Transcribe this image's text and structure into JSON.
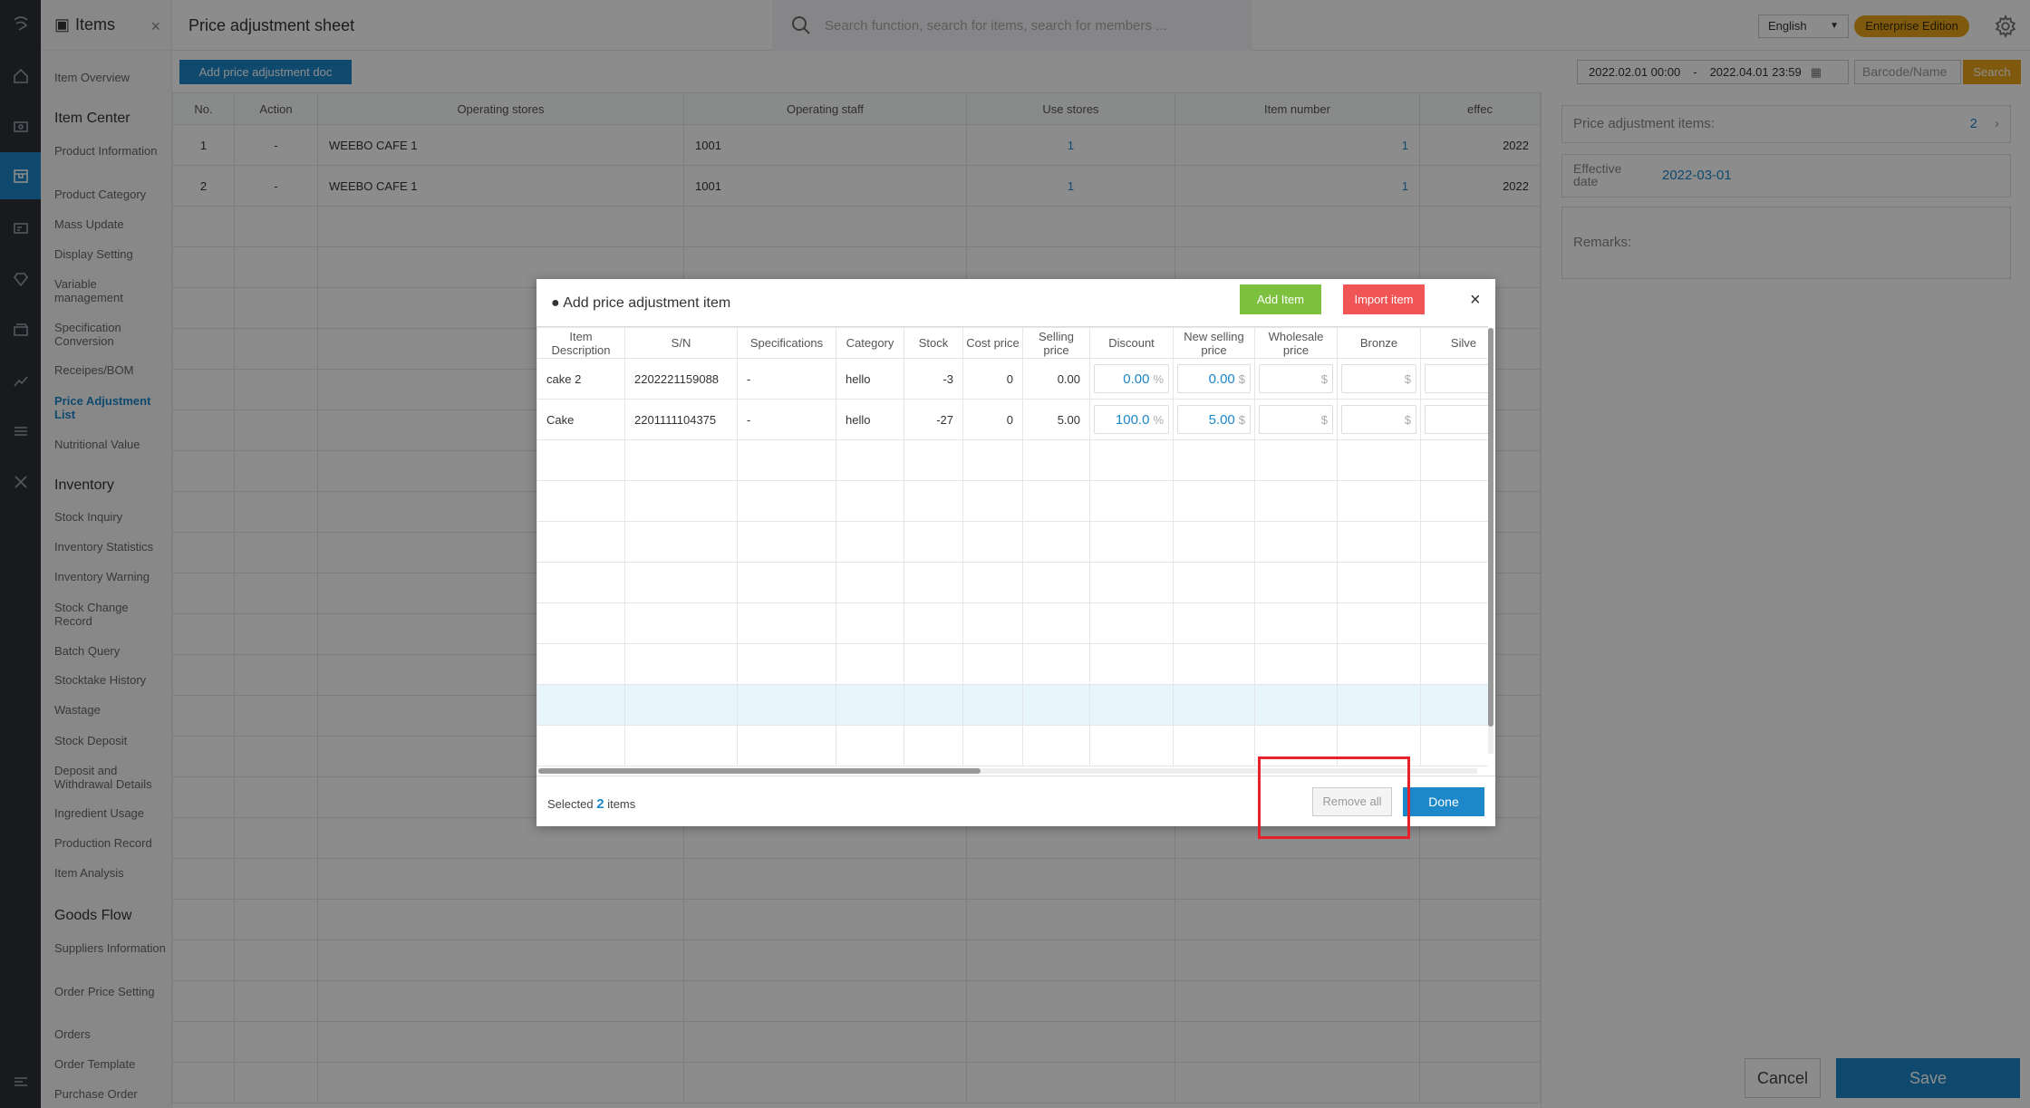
{
  "app": {
    "module_title": "Items",
    "page_title": "Price adjustment sheet"
  },
  "search": {
    "placeholder": "Search function, search for items, search for members ..."
  },
  "header": {
    "language": "English",
    "edition": "Enterprise Edition"
  },
  "sidebar": {
    "overview": "Item Overview",
    "sec_item_center": "Item Center",
    "item_center": [
      "Product Information",
      "Product Category",
      "Mass Update",
      "Display Setting",
      "Variable management",
      "Specification Conversion",
      "Receipes/BOM",
      "Price Adjustment List",
      "Nutritional Value"
    ],
    "sec_inventory": "Inventory",
    "inventory": [
      "Stock Inquiry",
      "Inventory Statistics",
      "Inventory Warning",
      "Stock Change Record",
      "Batch Query",
      "Stocktake History",
      "Wastage",
      "Stock Deposit",
      "Deposit and Withdrawal Details",
      "Ingredient Usage",
      "Production Record",
      "Item Analysis"
    ],
    "sec_goods_flow": "Goods Flow",
    "goods_flow": [
      "Suppliers Information",
      "Order Price Setting",
      "Orders",
      "Order Template",
      "Purchase Order"
    ]
  },
  "toolbar": {
    "add_doc": "Add price adjustment doc",
    "date_from": "2022.02.01 00:00",
    "date_sep": "-",
    "date_to": "2022.04.01 23:59",
    "barcode_placeholder": "Barcode/Name",
    "search": "Search"
  },
  "list": {
    "headers": [
      "No.",
      "Action",
      "Operating stores",
      "Operating staff",
      "Use stores",
      "Item number",
      "effec"
    ],
    "rows": [
      {
        "no": "1",
        "action": "-",
        "store": "WEEBO CAFE 1",
        "staff": "1001",
        "use": "1",
        "items": "1",
        "eff": "2022"
      },
      {
        "no": "2",
        "action": "-",
        "store": "WEEBO CAFE 1",
        "staff": "1001",
        "use": "1",
        "items": "1",
        "eff": "2022"
      }
    ]
  },
  "right_panel": {
    "items_label": "Price adjustment items:",
    "items_value": "2",
    "date_label": "Effective date",
    "date_value": "2022-03-01",
    "remarks_label": "Remarks:",
    "cancel": "Cancel",
    "save": "Save"
  },
  "modal": {
    "title": "● Add price adjustment item",
    "add_item": "Add Item",
    "import_item": "Import item",
    "close": "×",
    "headers": [
      "Item Description",
      "S/N",
      "Specifications",
      "Category",
      "Stock",
      "Cost price",
      "Selling price",
      "Discount",
      "New selling price",
      "Wholesale price",
      "Bronze",
      "Silve"
    ],
    "rows": [
      {
        "desc": "cake 2",
        "sn": "2202221159088",
        "spec": "-",
        "cat": "hello",
        "stock": "-3",
        "cost": "0",
        "sell": "0.00",
        "disc": "0.00",
        "new": "0.00"
      },
      {
        "desc": "Cake",
        "sn": "2201111104375",
        "spec": "-",
        "cat": "hello",
        "stock": "-27",
        "cost": "0",
        "sell": "5.00",
        "disc": "100.0",
        "new": "5.00"
      }
    ],
    "pct": "%",
    "cur": "$",
    "selected_prefix": "Selected",
    "selected_count": "2",
    "selected_suffix": "items",
    "remove_all": "Remove all",
    "done": "Done"
  },
  "colors": {
    "accent": "#1c87c9",
    "add": "#7dc13e",
    "import": "#f05454",
    "highlight": "#e8202a",
    "edition": "#e8a51a"
  }
}
